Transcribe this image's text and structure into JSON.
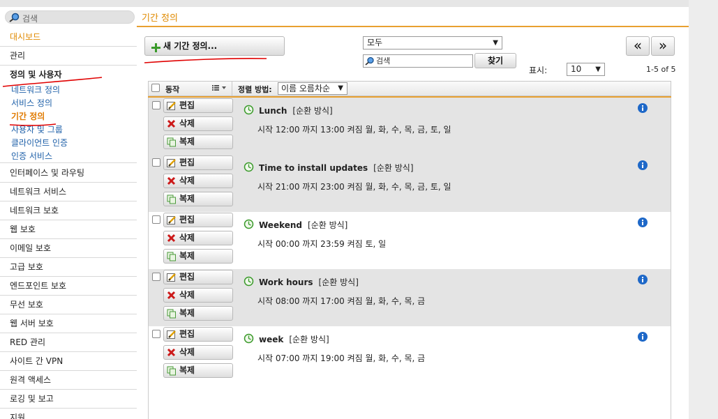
{
  "sidebar": {
    "search_placeholder": "검색",
    "items_top": [
      {
        "label": "대시보드"
      },
      {
        "label": "관리"
      },
      {
        "label": "정의 및 사용자"
      }
    ],
    "sub_items": [
      {
        "label": "네트워크 정의"
      },
      {
        "label": "서비스 정의"
      },
      {
        "label": "기간 정의"
      },
      {
        "label": "사용자 및 그룹"
      },
      {
        "label": "클라이언트 인증"
      },
      {
        "label": "인증 서비스"
      }
    ],
    "items_bottom": [
      {
        "label": "인터페이스 및 라우팅"
      },
      {
        "label": "네트워크 서비스"
      },
      {
        "label": "네트워크 보호"
      },
      {
        "label": "웹 보호"
      },
      {
        "label": "이메일 보호"
      },
      {
        "label": "고급 보호"
      },
      {
        "label": "엔드포인트 보호"
      },
      {
        "label": "무선 보호"
      },
      {
        "label": "웹 서버 보호"
      },
      {
        "label": "RED 관리"
      },
      {
        "label": "사이트 간 VPN"
      },
      {
        "label": "원격 액세스"
      },
      {
        "label": "로깅 및 보고"
      },
      {
        "label": "지원"
      }
    ]
  },
  "header": {
    "title": "기간 정의"
  },
  "toolbar": {
    "new_label": "새 기간 정의...",
    "filter_value": "모두",
    "search_value": "검색",
    "find_label": "찾기",
    "prev_label": "«",
    "next_label": "»",
    "show_label": "표시:",
    "per_page_value": "10",
    "page_count": "1-5 of 5"
  },
  "list": {
    "action_header": "동작",
    "sort_label": "정렬 방법:",
    "sort_value": "이름 오름차순",
    "edit_label": "편집",
    "delete_label": "삭제",
    "copy_label": "복제",
    "rows": [
      {
        "name": "Lunch",
        "type": "[순환 방식]",
        "desc": "시작  12:00 까지 13:00 켜짐 월, 화, 수, 목, 금, 토, 일"
      },
      {
        "name": "Time to install updates",
        "type": "[순환 방식]",
        "desc": "시작  21:00 까지 23:00 켜짐 월, 화, 수, 목, 금, 토, 일"
      },
      {
        "name": "Weekend",
        "type": "[순환 방식]",
        "desc": "시작  00:00 까지 23:59 켜짐 토, 일"
      },
      {
        "name": "Work hours",
        "type": "[순환 방식]",
        "desc": "시작  08:00 까지 17:00 켜짐 월, 화, 수, 목, 금"
      },
      {
        "name": "week",
        "type": "[순환 방식]",
        "desc": "시작  07:00 까지 19:00 켜짐 월, 화, 수, 목, 금"
      }
    ]
  },
  "colors": {
    "accent": "#e8a030",
    "link": "#1d5fa8",
    "annotation": "#e00000"
  }
}
